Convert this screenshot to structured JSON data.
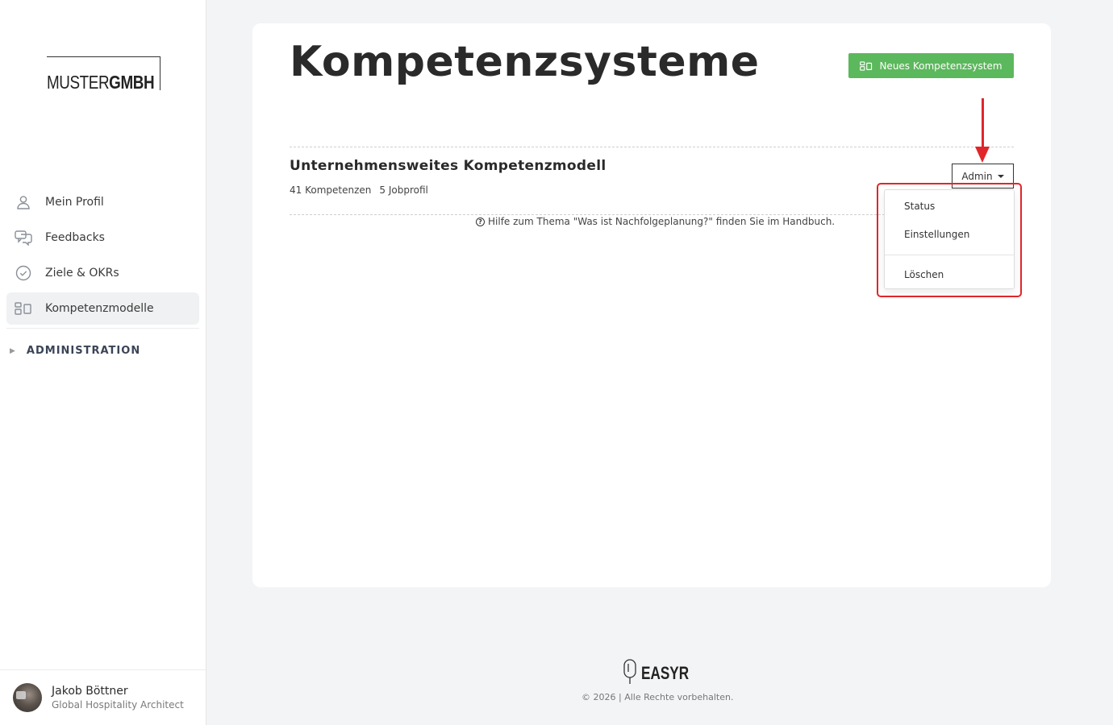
{
  "brand": {
    "logo_thin": "MUSTER",
    "logo_bold": "GMBH"
  },
  "sidebar": {
    "items": [
      {
        "label": "Mein Profil",
        "icon": "user-icon"
      },
      {
        "label": "Feedbacks",
        "icon": "chat-icon"
      },
      {
        "label": "Ziele & OKRs",
        "icon": "check-circle-icon"
      },
      {
        "label": "Kompetenzmodelle",
        "icon": "competency-icon",
        "active": true
      }
    ],
    "admin_label": "ADMINISTRATION"
  },
  "user": {
    "name": "Jakob Böttner",
    "role": "Global Hospitality Architect"
  },
  "main": {
    "title": "Kompetenzsysteme",
    "new_button": "Neues Kompetenzsystem",
    "model": {
      "title": "Unternehmensweites Kompetenzmodell",
      "competencies": "41 Kompetenzen",
      "jobprofiles": "5 Jobprofil"
    },
    "help_text": "Hilfe zum Thema \"Was ist Nachfolgeplanung?\" finden Sie im Handbuch.",
    "admin_button": "Admin",
    "admin_menu": [
      "Status",
      "Einstellungen",
      "Löschen"
    ]
  },
  "footer": {
    "wordmark": "EASYR",
    "copyright": "© 2026 | Alle Rechte vorbehalten."
  },
  "colors": {
    "accent_green": "#5cb85c",
    "highlight_red": "#e0262a"
  }
}
